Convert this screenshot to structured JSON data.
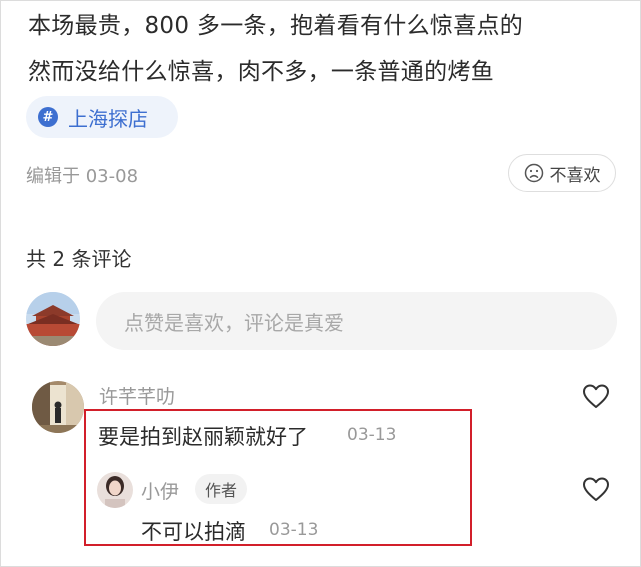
{
  "post": {
    "line1": "本场最贵，800 多一条，抱着看有什么惊喜点的",
    "line2": "然而没给什么惊喜，肉不多，一条普通的烤鱼",
    "tag": {
      "icon": "hashtag-icon",
      "symbol": "#",
      "label": "上海探店"
    },
    "edited": "编辑于 03-08",
    "dislike": {
      "icon": "sad-face-icon",
      "label": "不喜欢"
    }
  },
  "comments_section": {
    "count_label": "共 2 条评论",
    "input_placeholder": "点赞是喜欢，评论是真爱",
    "comments": [
      {
        "username": "许芊芊叻",
        "text": "要是拍到赵丽颖就好了",
        "date": "03-13",
        "icon": "heart-outline-icon",
        "reply": {
          "username": "小伊",
          "badge": "作者",
          "text": "不可以拍滴",
          "date": "03-13",
          "icon": "heart-outline-icon"
        }
      }
    ]
  },
  "colors": {
    "tag_accent": "#3d6fd0",
    "tag_background": "#eef3fb",
    "highlight_border": "#d21f2a",
    "input_background": "#f4f4f4",
    "muted_text": "#999999"
  }
}
